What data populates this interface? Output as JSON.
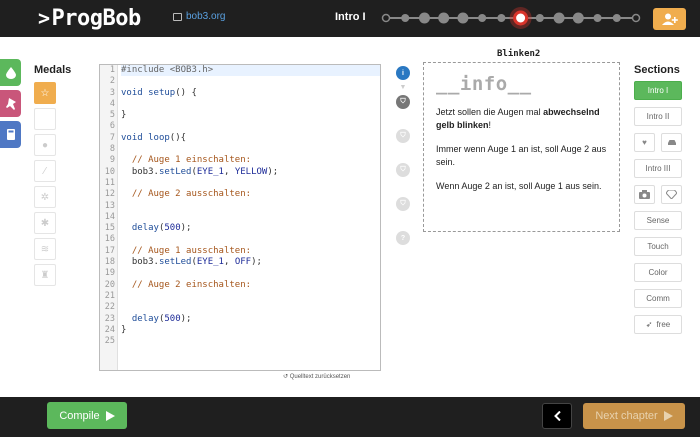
{
  "header": {
    "logo": "ProgBob",
    "repo": "bob3.org",
    "chapter": "Intro I",
    "progress": {
      "total_steps": 14,
      "current_index": 7
    }
  },
  "medals": {
    "title": "Medals",
    "items": [
      "star-icon",
      "blank",
      "drop-icon",
      "wand-icon",
      "gear-icon",
      "bug-icon",
      "wifi-icon",
      "trophy-icon"
    ]
  },
  "leftnav": [
    "drop-icon",
    "pin-icon",
    "book-icon"
  ],
  "editor": {
    "lines": [
      "#include <BOB3.h>",
      "",
      "void setup() {",
      "",
      "}",
      "",
      "void loop(){",
      "",
      "  // Auge 1 einschalten:",
      "  bob3.setLed(EYE_1, YELLOW);",
      "",
      "  // Auge 2 ausschalten:",
      "",
      "",
      "  delay(500);",
      "",
      "  // Auge 1 ausschalten:",
      "  bob3.setLed(EYE_1, OFF);",
      "",
      "  // Auge 2 einschalten:",
      "",
      "",
      "  delay(500);",
      "}",
      ""
    ],
    "reset_label": "↺ Quelltext zurücksetzen"
  },
  "info": {
    "sheet": "Blinken2",
    "title": "__info__",
    "p1_a": "Jetzt sollen die Augen mal ",
    "p1_b": "abwechselnd gelb blinken",
    "p1_c": "!",
    "p2": "Immer wenn Auge 1 an ist, soll Auge 2 aus sein.",
    "p3": "Wenn Auge 2 an ist, soll Auge 1 aus sein."
  },
  "steps": [
    "i",
    "shield",
    "shield",
    "shield",
    "shield",
    "?"
  ],
  "sections": {
    "title": "Sections",
    "intro1": "Intro I",
    "intro2": "Intro II",
    "intro3": "Intro III",
    "sense": "Sense",
    "touch": "Touch",
    "color": "Color",
    "comm": "Comm",
    "free": "free"
  },
  "footer": {
    "compile": "Compile",
    "next": "Next chapter"
  }
}
